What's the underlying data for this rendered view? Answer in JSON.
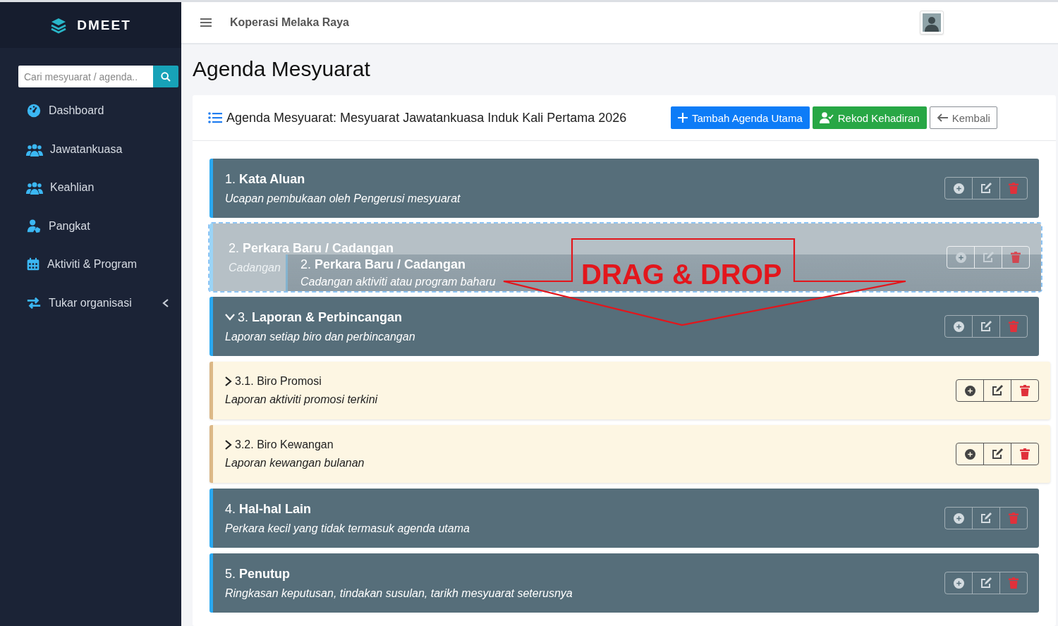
{
  "sidebar": {
    "brand": "DMEET",
    "search": {
      "placeholder": "Cari mesyuarat / agenda.."
    },
    "items": [
      {
        "label": "Dashboard",
        "has_submenu": false
      },
      {
        "label": "Jawatankuasa",
        "has_submenu": false
      },
      {
        "label": "Keahlian",
        "has_submenu": false
      },
      {
        "label": "Pangkat",
        "has_submenu": false
      },
      {
        "label": "Aktiviti & Program",
        "has_submenu": false
      },
      {
        "label": "Tukar organisasi",
        "has_submenu": true
      }
    ]
  },
  "header": {
    "organization": "Koperasi Melaka Raya"
  },
  "page_title": "Agenda Mesyuarat",
  "card": {
    "title": "Agenda Mesyuarat: Mesyuarat Jawatankuasa Induk Kali Pertama 2026",
    "buttons": [
      {
        "label": "Tambah Agenda Utama",
        "kind": "add"
      },
      {
        "label": "Rekod Kehadiran",
        "kind": "attendance"
      },
      {
        "label": "Kembali",
        "kind": "back"
      }
    ]
  },
  "agenda": [
    {
      "number": "1.",
      "title": "Kata Aluan",
      "description": "Ucapan pembukaan oleh Pengerusi mesyuarat",
      "dragging": false
    },
    {
      "number": "2.",
      "title": "Perkara Baru / Cadangan",
      "description": "Cadangan",
      "dragging": true
    },
    {
      "number": "3.",
      "title": "Laporan & Perbincangan",
      "description": "Laporan setiap biro dan perbincangan",
      "dragging": false,
      "expanded": true,
      "children": [
        {
          "number": "3.1.",
          "title": "Biro Promosi",
          "description": "Laporan aktiviti promosi terkini",
          "dragging": false,
          "expanded": false
        },
        {
          "number": "3.2.",
          "title": "Biro Kewangan",
          "description": "Laporan kewangan bulanan",
          "dragging": false,
          "expanded": false
        }
      ]
    },
    {
      "number": "4.",
      "title": "Hal-hal Lain",
      "description": "Perkara kecil yang tidak termasuk agenda utama",
      "dragging": false
    },
    {
      "number": "5.",
      "title": "Penutup",
      "description": "Ringkasan keputusan, tindakan susulan, tarikh mesyuarat seterusnya",
      "dragging": false
    }
  ],
  "drag_preview": {
    "number": "2.",
    "title": "Perkara Baru / Cadangan",
    "description": "Cadangan aktiviti atau program baharu"
  },
  "annotation": {
    "text": "DRAG & DROP"
  }
}
